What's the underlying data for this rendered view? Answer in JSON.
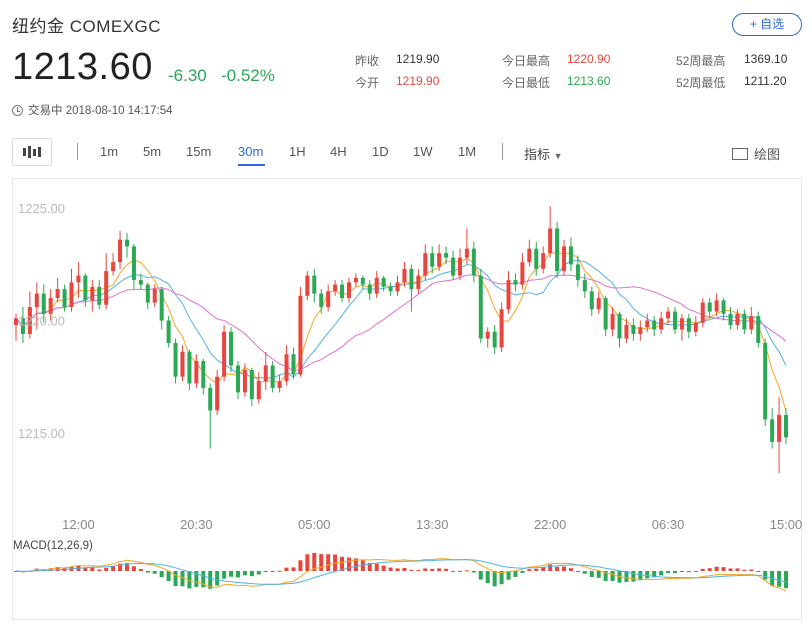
{
  "header": {
    "title": "纽约金  COMEXGC",
    "watch_label": "+ 自选",
    "price": "1213.60",
    "change": "-6.30",
    "change_pct": "-0.52%",
    "status": "交易中 2018-08-10 14:17:54"
  },
  "quote": {
    "prev_close_label": "昨收",
    "prev_close": "1219.90",
    "open_label": "今开",
    "open": "1219.90",
    "high_label": "今日最高",
    "high": "1220.90",
    "low_label": "今日最低",
    "low": "1213.60",
    "w52_high_label": "52周最高",
    "w52_high": "1369.10",
    "w52_low_label": "52周最低",
    "w52_low": "1211.20"
  },
  "toolbar": {
    "periods": [
      "1m",
      "5m",
      "15m",
      "30m",
      "1H",
      "4H",
      "1D",
      "1W",
      "1M"
    ],
    "active_period": "30m",
    "indicator_label": "指标",
    "draw_label": "绘图"
  },
  "colors": {
    "up": "#e8453c",
    "down": "#2aa854",
    "ma_short": "#f5a623",
    "ma_mid": "#4fb2e8",
    "ma_long": "#e36fd3",
    "accent": "#2f6bd8"
  },
  "chart_data": {
    "type": "candlestick",
    "y_ticks": [
      "1225.00",
      "1220.00",
      "1215.00"
    ],
    "y_tick_values": [
      1225,
      1220,
      1215
    ],
    "ylim": [
      1212.1,
      1225.9
    ],
    "x_tick_labels": [
      "12:00",
      "20:30",
      "05:00",
      "13:30",
      "22:00",
      "06:30",
      "15:00"
    ],
    "x_tick_index": [
      9,
      26,
      43,
      60,
      77,
      94,
      111
    ],
    "candles": [
      [
        1219.8,
        1220.1,
        1219.1,
        1220.3
      ],
      [
        1220.1,
        1219.4,
        1219.0,
        1220.6
      ],
      [
        1219.4,
        1220.6,
        1219.2,
        1221.3
      ],
      [
        1220.6,
        1221.2,
        1219.6,
        1221.7
      ],
      [
        1221.2,
        1220.3,
        1219.9,
        1221.6
      ],
      [
        1220.3,
        1221.0,
        1220.0,
        1221.4
      ],
      [
        1221.0,
        1221.4,
        1220.8,
        1221.9
      ],
      [
        1221.4,
        1220.6,
        1220.4,
        1221.6
      ],
      [
        1220.6,
        1221.7,
        1220.4,
        1222.3
      ],
      [
        1221.7,
        1222.0,
        1221.0,
        1222.6
      ],
      [
        1222.0,
        1220.9,
        1220.6,
        1222.1
      ],
      [
        1220.9,
        1221.5,
        1220.4,
        1221.8
      ],
      [
        1221.5,
        1220.7,
        1220.5,
        1221.8
      ],
      [
        1220.7,
        1222.2,
        1220.5,
        1223.0
      ],
      [
        1222.2,
        1222.6,
        1222.0,
        1223.0
      ],
      [
        1222.6,
        1223.6,
        1222.3,
        1224.0
      ],
      [
        1223.6,
        1223.3,
        1222.8,
        1223.9
      ],
      [
        1223.3,
        1221.8,
        1221.4,
        1223.4
      ],
      [
        1221.8,
        1221.6,
        1221.4,
        1222.1
      ],
      [
        1221.6,
        1220.8,
        1220.5,
        1221.7
      ],
      [
        1220.8,
        1221.4,
        1220.6,
        1221.6
      ],
      [
        1221.4,
        1220.0,
        1219.6,
        1221.5
      ],
      [
        1220.0,
        1219.0,
        1218.8,
        1220.2
      ],
      [
        1219.0,
        1217.5,
        1217.2,
        1219.2
      ],
      [
        1217.5,
        1218.6,
        1217.3,
        1218.9
      ],
      [
        1218.6,
        1217.2,
        1216.9,
        1218.7
      ],
      [
        1217.2,
        1218.2,
        1217.0,
        1218.5
      ],
      [
        1218.2,
        1217.0,
        1216.7,
        1218.3
      ],
      [
        1217.0,
        1216.0,
        1214.3,
        1217.2
      ],
      [
        1216.0,
        1217.5,
        1215.8,
        1217.8
      ],
      [
        1217.5,
        1219.5,
        1217.3,
        1219.8
      ],
      [
        1219.5,
        1218.0,
        1217.7,
        1219.7
      ],
      [
        1218.0,
        1216.8,
        1216.5,
        1218.2
      ],
      [
        1216.8,
        1217.8,
        1216.6,
        1218.1
      ],
      [
        1217.8,
        1216.5,
        1216.2,
        1217.9
      ],
      [
        1216.5,
        1217.3,
        1216.3,
        1217.7
      ],
      [
        1217.3,
        1218.0,
        1216.9,
        1218.6
      ],
      [
        1218.0,
        1217.0,
        1216.8,
        1218.2
      ],
      [
        1217.0,
        1217.3,
        1216.8,
        1217.6
      ],
      [
        1217.3,
        1218.5,
        1217.1,
        1218.9
      ],
      [
        1218.5,
        1217.6,
        1217.4,
        1218.8
      ],
      [
        1217.6,
        1221.1,
        1217.5,
        1221.5
      ],
      [
        1221.1,
        1222.0,
        1220.9,
        1222.2
      ],
      [
        1222.0,
        1221.2,
        1220.8,
        1222.3
      ],
      [
        1221.2,
        1220.6,
        1220.3,
        1221.4
      ],
      [
        1220.6,
        1221.3,
        1220.4,
        1221.6
      ],
      [
        1221.3,
        1221.6,
        1221.1,
        1221.8
      ],
      [
        1221.6,
        1221.0,
        1220.8,
        1221.8
      ],
      [
        1221.0,
        1221.7,
        1220.8,
        1221.9
      ],
      [
        1221.7,
        1221.9,
        1221.5,
        1222.1
      ],
      [
        1221.9,
        1221.6,
        1221.4,
        1222.0
      ],
      [
        1221.6,
        1221.2,
        1220.9,
        1221.8
      ],
      [
        1221.2,
        1221.9,
        1221.0,
        1222.2
      ],
      [
        1221.9,
        1221.5,
        1221.3,
        1222.0
      ],
      [
        1221.5,
        1221.3,
        1221.1,
        1221.7
      ],
      [
        1221.3,
        1221.7,
        1221.1,
        1222.0
      ],
      [
        1221.7,
        1222.3,
        1221.5,
        1222.6
      ],
      [
        1222.3,
        1221.4,
        1220.4,
        1222.5
      ],
      [
        1221.4,
        1222.0,
        1221.2,
        1222.3
      ],
      [
        1222.0,
        1223.0,
        1221.8,
        1223.4
      ],
      [
        1223.0,
        1222.4,
        1222.1,
        1223.3
      ],
      [
        1222.4,
        1223.0,
        1222.2,
        1223.4
      ],
      [
        1223.0,
        1222.8,
        1222.5,
        1223.3
      ],
      [
        1222.8,
        1222.0,
        1221.8,
        1223.1
      ],
      [
        1222.0,
        1222.8,
        1221.8,
        1223.2
      ],
      [
        1222.8,
        1223.2,
        1222.5,
        1224.1
      ],
      [
        1223.2,
        1222.0,
        1221.7,
        1223.5
      ],
      [
        1222.0,
        1219.2,
        1219.0,
        1222.3
      ],
      [
        1219.2,
        1219.5,
        1218.8,
        1219.7
      ],
      [
        1219.5,
        1218.8,
        1218.5,
        1219.8
      ],
      [
        1218.8,
        1220.5,
        1218.6,
        1220.8
      ],
      [
        1220.5,
        1221.8,
        1220.3,
        1222.2
      ],
      [
        1221.8,
        1221.6,
        1221.3,
        1222.1
      ],
      [
        1221.6,
        1222.6,
        1221.4,
        1223.0
      ],
      [
        1222.6,
        1223.2,
        1222.4,
        1223.6
      ],
      [
        1223.2,
        1222.3,
        1222.0,
        1223.5
      ],
      [
        1222.3,
        1223.0,
        1222.1,
        1223.3
      ],
      [
        1223.0,
        1224.1,
        1222.8,
        1225.1
      ],
      [
        1224.1,
        1222.2,
        1221.9,
        1224.4
      ],
      [
        1222.2,
        1223.3,
        1222.0,
        1223.6
      ],
      [
        1223.3,
        1222.5,
        1222.2,
        1223.7
      ],
      [
        1222.5,
        1221.8,
        1221.5,
        1222.9
      ],
      [
        1221.8,
        1221.3,
        1221.0,
        1222.1
      ],
      [
        1221.3,
        1220.5,
        1220.2,
        1221.5
      ],
      [
        1220.5,
        1221.0,
        1220.3,
        1221.3
      ],
      [
        1221.0,
        1219.6,
        1219.3,
        1221.1
      ],
      [
        1219.6,
        1220.3,
        1219.3,
        1220.6
      ],
      [
        1220.3,
        1219.2,
        1218.8,
        1220.4
      ],
      [
        1219.2,
        1219.8,
        1219.0,
        1220.1
      ],
      [
        1219.8,
        1219.4,
        1219.1,
        1220.1
      ],
      [
        1219.4,
        1219.7,
        1219.1,
        1220.0
      ],
      [
        1219.7,
        1220.0,
        1219.5,
        1220.3
      ],
      [
        1220.0,
        1219.6,
        1219.3,
        1220.2
      ],
      [
        1219.6,
        1220.1,
        1219.4,
        1220.4
      ],
      [
        1220.1,
        1220.4,
        1219.8,
        1220.6
      ],
      [
        1220.4,
        1219.6,
        1219.4,
        1220.6
      ],
      [
        1219.6,
        1220.1,
        1219.1,
        1220.3
      ],
      [
        1220.1,
        1219.5,
        1219.2,
        1220.3
      ],
      [
        1219.5,
        1219.9,
        1219.3,
        1220.2
      ],
      [
        1219.9,
        1220.8,
        1219.7,
        1221.0
      ],
      [
        1220.8,
        1220.4,
        1220.1,
        1221.0
      ],
      [
        1220.4,
        1220.9,
        1220.2,
        1221.2
      ],
      [
        1220.9,
        1220.3,
        1220.0,
        1221.0
      ],
      [
        1220.3,
        1219.8,
        1219.6,
        1220.6
      ],
      [
        1219.8,
        1220.3,
        1219.6,
        1220.5
      ],
      [
        1220.3,
        1219.6,
        1219.4,
        1220.5
      ],
      [
        1219.6,
        1220.2,
        1219.4,
        1220.6
      ],
      [
        1220.2,
        1219.0,
        1218.8,
        1220.4
      ],
      [
        1219.0,
        1215.6,
        1215.3,
        1219.2
      ],
      [
        1215.6,
        1214.6,
        1214.3,
        1216.1
      ],
      [
        1214.6,
        1215.8,
        1213.2,
        1216.6
      ],
      [
        1215.8,
        1214.8,
        1214.5,
        1216.1
      ]
    ],
    "macd_label": "MACD(12,26,9)"
  }
}
